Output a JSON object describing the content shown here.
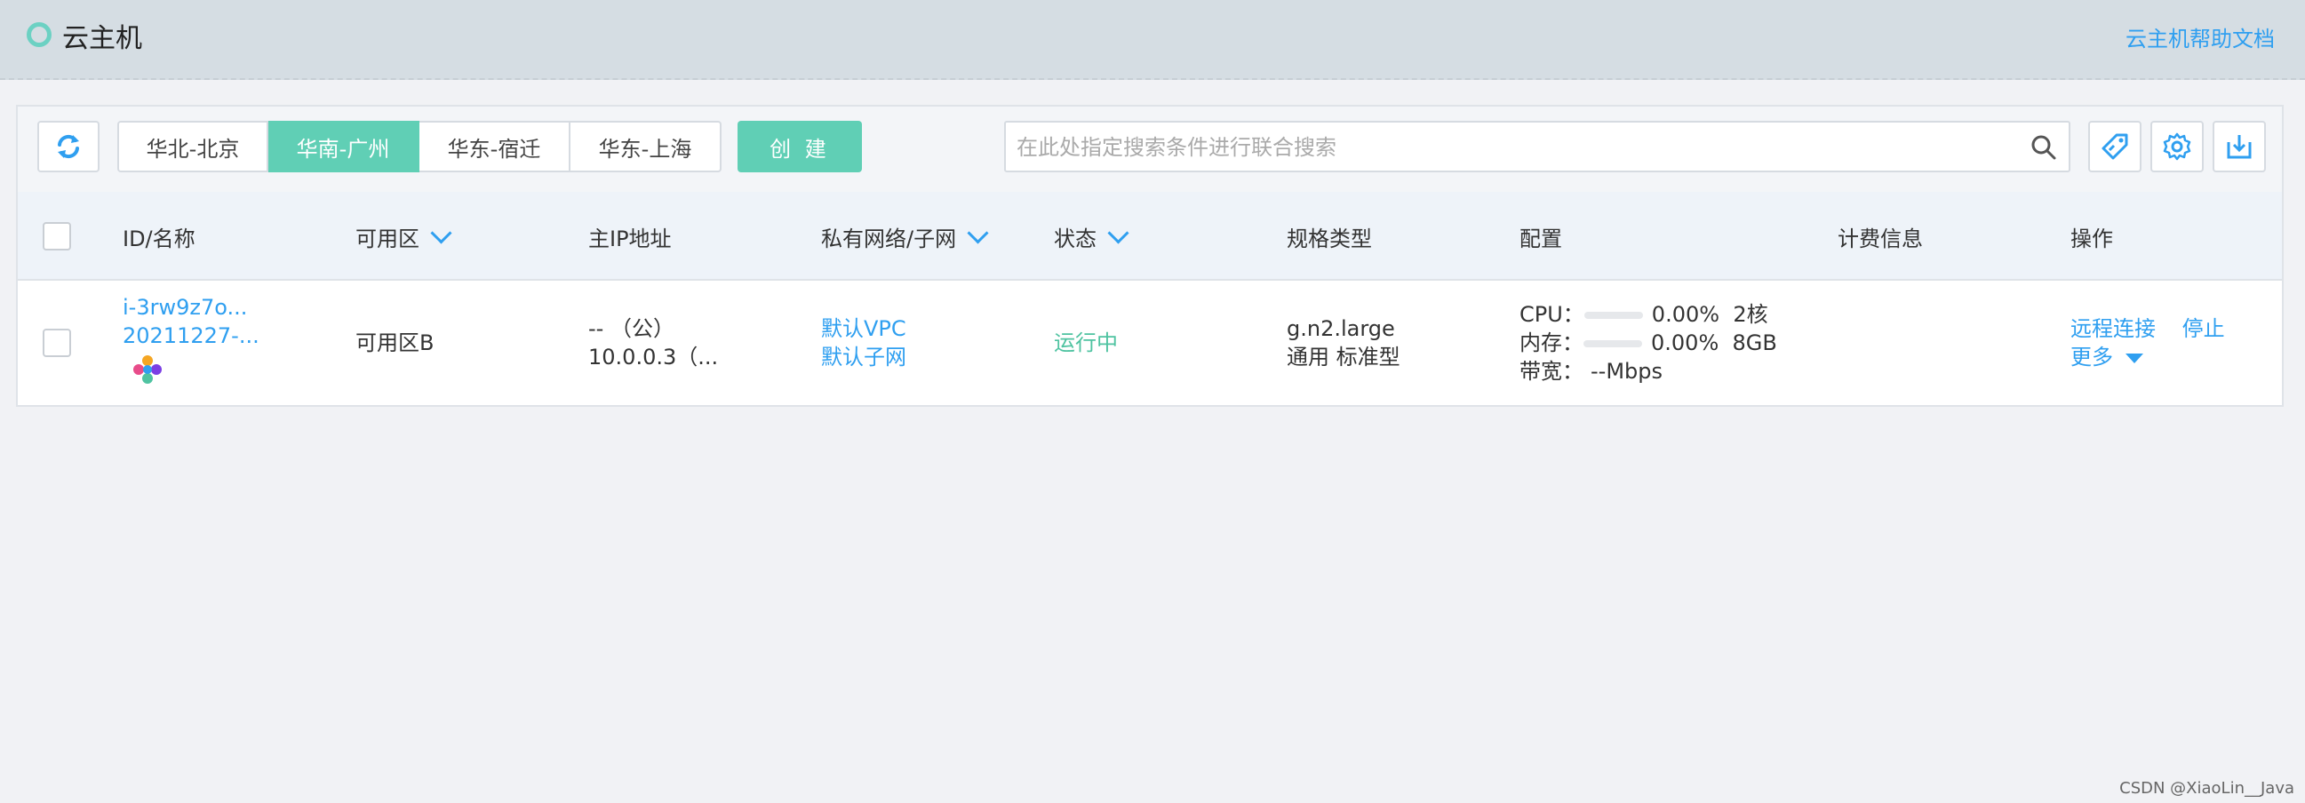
{
  "header": {
    "title": "云主机",
    "help_link": "云主机帮助文档"
  },
  "toolbar": {
    "regions": [
      {
        "label": "华北-北京",
        "active": false
      },
      {
        "label": "华南-广州",
        "active": true
      },
      {
        "label": "华东-宿迁",
        "active": false
      },
      {
        "label": "华东-上海",
        "active": false
      }
    ],
    "create_label": "创 建",
    "search_placeholder": "在此处指定搜索条件进行联合搜索"
  },
  "table": {
    "columns": {
      "id_name": "ID/名称",
      "zone": "可用区",
      "ip": "主IP地址",
      "vpc": "私有网络/子网",
      "status": "状态",
      "spec": "规格类型",
      "config": "配置",
      "billing": "计费信息",
      "actions": "操作"
    },
    "rows": [
      {
        "id": "i-3rw9z7o...",
        "name": "20211227-...",
        "zone": "可用区B",
        "ip_public": "-- （公）",
        "ip_private": "10.0.0.3（...",
        "vpc": "默认VPC",
        "subnet": "默认子网",
        "status": "运行中",
        "spec_name": "g.n2.large",
        "spec_type": "通用 标准型",
        "cpu_label": "CPU：",
        "cpu_usage": "0.00%",
        "cpu_usage_fraction": 0.0,
        "cpu_cores": "2核",
        "mem_label": "内存：",
        "mem_usage": "0.00%",
        "mem_usage_fraction": 0.0,
        "mem_size": "8GB",
        "bw_label": "带宽：",
        "bw_value": "--Mbps",
        "billing": "",
        "action_remote": "远程连接",
        "action_stop": "停止",
        "action_more": "更多"
      }
    ]
  },
  "watermark": "CSDN @XiaoLin__Java",
  "colors": {
    "accent_green": "#60cfb5",
    "link_blue": "#2f9ff0",
    "header_bg": "#d5dde3"
  }
}
